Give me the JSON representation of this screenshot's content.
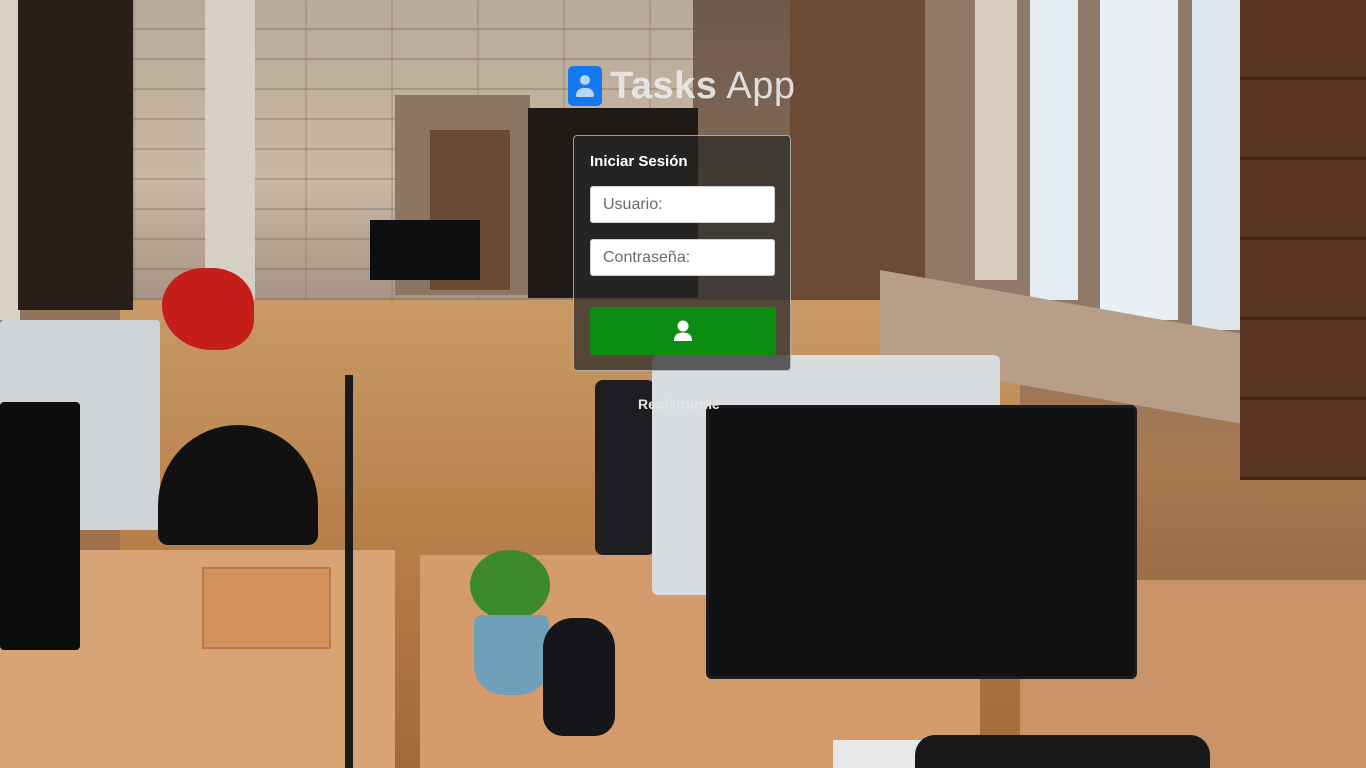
{
  "app": {
    "title_bold": "Tasks",
    "title_light": "App",
    "logo_icon": "user-id-card-icon",
    "brand_color": "#1479f0"
  },
  "login": {
    "heading": "Iniciar Sesión",
    "username": {
      "placeholder": "Usuario:",
      "value": ""
    },
    "password": {
      "placeholder": "Contraseña:",
      "value": ""
    },
    "submit": {
      "icon": "user-icon",
      "color": "#0c8d12"
    }
  },
  "register": {
    "label": "Registrarme"
  },
  "background": {
    "description_icon": "office-photo"
  }
}
